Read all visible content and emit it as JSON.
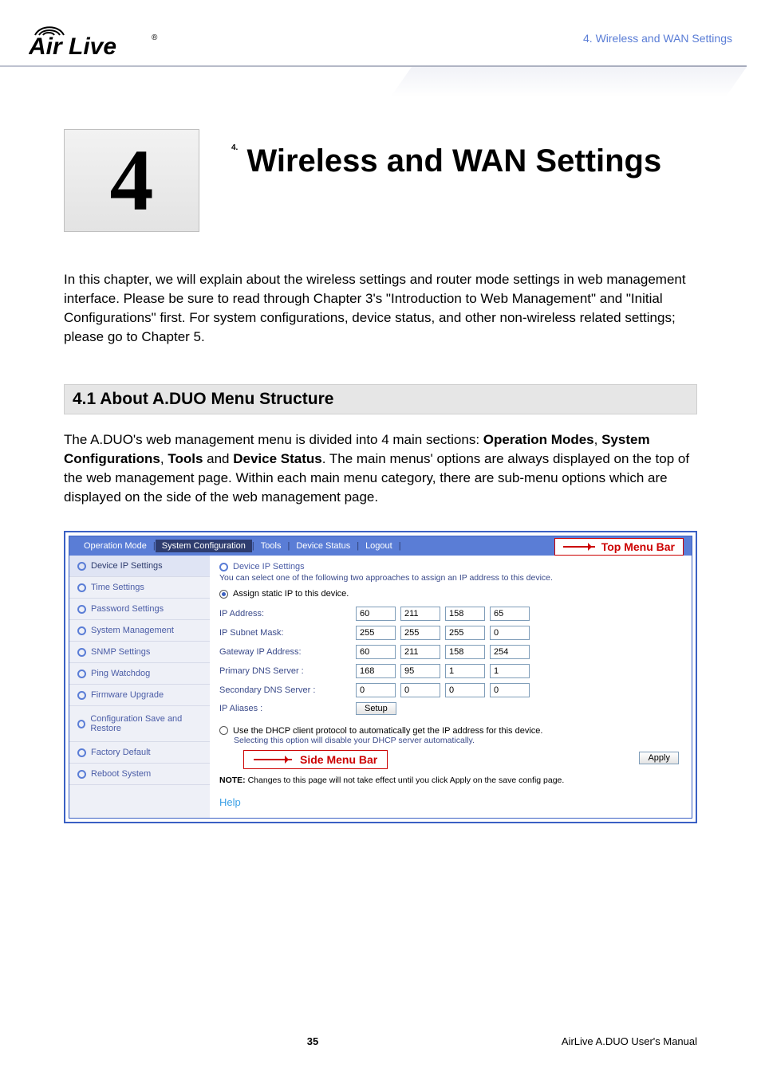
{
  "header": {
    "breadcrumb": "4.  Wireless  and  WAN  Settings",
    "logo_text": "Air Live"
  },
  "chapter": {
    "number": "4",
    "title": "Wireless and WAN Settings",
    "title_prefix": "4."
  },
  "intro_paragraph": "In this chapter, we will explain about the wireless settings and router mode settings in web management interface. Please be sure to read through Chapter 3's \"Introduction to Web Management\" and \"Initial Configurations\" first. For system configurations, device status, and other non-wireless related settings; please go to Chapter 5.",
  "section": {
    "heading": "4.1 About A.DUO Menu Structure"
  },
  "section_paragraph_parts": {
    "p1": "The A.DUO's web management menu is divided into 4 main sections: ",
    "b1": "Operation Modes",
    "p2": ", ",
    "b2": "System Configurations",
    "p3": ", ",
    "b3": "Tools",
    "p4": " and ",
    "b4": "Device Status",
    "p5": ". The main menus' options are always displayed on the top of the web management page. Within each main menu category, there are sub-menu options which are displayed on the side of the web management page."
  },
  "screenshot": {
    "top_menu": {
      "items": [
        "Operation Mode",
        "System Configuration",
        "Tools",
        "Device Status",
        "Logout"
      ],
      "active_index": 1,
      "badge": "Top Menu Bar"
    },
    "sidebar": {
      "items": [
        "Device IP Settings",
        "Time Settings",
        "Password Settings",
        "System Management",
        "SNMP Settings",
        "Ping Watchdog",
        "Firmware Upgrade",
        "Configuration Save and Restore",
        "Factory Default",
        "Reboot System"
      ],
      "active_index": 0,
      "badge": "Side Menu Bar"
    },
    "main": {
      "panel_title": "Device IP Settings",
      "panel_sub": "You can select one of the following two approaches to assign an IP address to this device.",
      "radio_static": "Assign static IP to this device.",
      "fields": {
        "ip_address_label": "IP Address:",
        "ip_address": [
          "60",
          "211",
          "158",
          "65"
        ],
        "subnet_label": "IP Subnet Mask:",
        "subnet": [
          "255",
          "255",
          "255",
          "0"
        ],
        "gateway_label": "Gateway IP Address:",
        "gateway": [
          "60",
          "211",
          "158",
          "254"
        ],
        "dns1_label": "Primary DNS Server :",
        "dns1": [
          "168",
          "95",
          "1",
          "1"
        ],
        "dns2_label": "Secondary DNS Server :",
        "dns2": [
          "0",
          "0",
          "0",
          "0"
        ],
        "aliases_label": "IP Aliases :",
        "setup_btn": "Setup"
      },
      "radio_dhcp": "Use the DHCP client protocol to automatically get the IP address for this device.",
      "dhcp_sub": "Selecting this option will disable your DHCP server automatically.",
      "apply_btn": "Apply",
      "note_prefix": "NOTE:",
      "note_rest": " Changes to this page will not take effect until you click Apply on the save config page.",
      "help": "Help"
    }
  },
  "footer": {
    "page": "35",
    "manual": "AirLive A.DUO User's Manual"
  }
}
